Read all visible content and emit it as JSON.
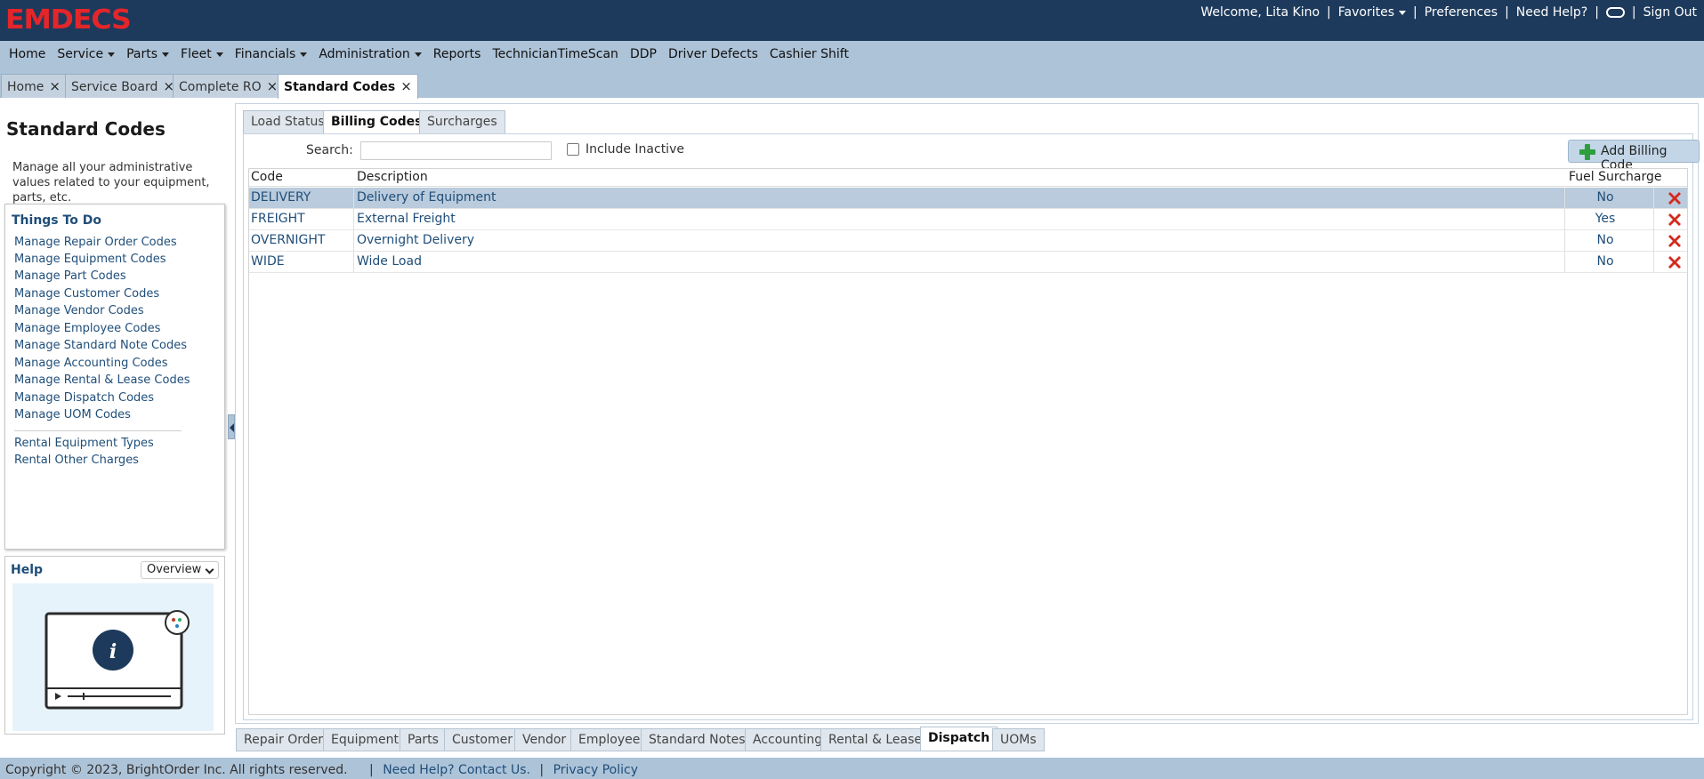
{
  "app": {
    "logo_text": "EMDECS",
    "brand_color": "#e4262b",
    "header_color": "#1d3a5c",
    "accent_color": "#adc3d8"
  },
  "user_bar": {
    "welcome": "Welcome, Lita Kino",
    "favorites": "Favorites",
    "preferences": "Preferences",
    "need_help": "Need Help?",
    "chat_icon": "pill-icon",
    "sign_out": "Sign Out"
  },
  "main_menu": [
    {
      "label": "Home",
      "dropdown": false
    },
    {
      "label": "Service",
      "dropdown": true
    },
    {
      "label": "Parts",
      "dropdown": true
    },
    {
      "label": "Fleet",
      "dropdown": true
    },
    {
      "label": "Financials",
      "dropdown": true
    },
    {
      "label": "Administration",
      "dropdown": true
    },
    {
      "label": "Reports",
      "dropdown": false
    },
    {
      "label": "TechnicianTimeScan",
      "dropdown": false
    },
    {
      "label": "DDP",
      "dropdown": false
    },
    {
      "label": "Driver Defects",
      "dropdown": false
    },
    {
      "label": "Cashier Shift",
      "dropdown": false
    }
  ],
  "page_tabs": [
    {
      "label": "Home",
      "active": false
    },
    {
      "label": "Service Board",
      "active": false
    },
    {
      "label": "Complete RO",
      "active": false
    },
    {
      "label": "Standard Codes",
      "active": true
    }
  ],
  "left_panel": {
    "title": "Standard Codes",
    "description": "Manage all your administrative values related to your equipment, parts, etc.",
    "things_to_do_title": "Things To Do",
    "links": [
      "Manage Repair Order Codes",
      "Manage Equipment Codes",
      "Manage Part Codes",
      "Manage Customer Codes",
      "Manage Vendor Codes",
      "Manage Employee Codes",
      "Manage Standard Note Codes",
      "Manage Accounting Codes",
      "Manage Rental & Lease Codes",
      "Manage Dispatch Codes",
      "Manage UOM Codes"
    ],
    "extra_links": [
      "Rental Equipment Types",
      "Rental Other Charges"
    ],
    "help_title": "Help",
    "help_select_value": "Overview",
    "help_image_icon": "video-info-icon"
  },
  "inner_tabs": [
    {
      "label": "Load Status",
      "active": false
    },
    {
      "label": "Billing Codes",
      "active": true
    },
    {
      "label": "Surcharges",
      "active": false
    }
  ],
  "toolbar": {
    "search_label": "Search:",
    "search_value": "",
    "search_placeholder": "",
    "include_inactive_label": "Include Inactive",
    "include_inactive_checked": false,
    "add_button_label": "Add Billing Code",
    "add_icon": "plus-icon",
    "delete_icon": "trash-icon"
  },
  "grid": {
    "columns": [
      "Code",
      "Description",
      "Fuel Surcharge"
    ],
    "rows": [
      {
        "code": "DELIVERY",
        "description": "Delivery of Equipment",
        "fuel_surcharge": "No",
        "selected": true
      },
      {
        "code": "FREIGHT",
        "description": "External Freight",
        "fuel_surcharge": "Yes",
        "selected": false
      },
      {
        "code": "OVERNIGHT",
        "description": "Overnight Delivery",
        "fuel_surcharge": "No",
        "selected": false
      },
      {
        "code": "WIDE",
        "description": "Wide Load",
        "fuel_surcharge": "No",
        "selected": false
      }
    ],
    "row_delete_icon": "red-x-icon"
  },
  "bottom_tabs": [
    {
      "label": "Repair Order",
      "active": false
    },
    {
      "label": "Equipment",
      "active": false
    },
    {
      "label": "Parts",
      "active": false
    },
    {
      "label": "Customer",
      "active": false
    },
    {
      "label": "Vendor",
      "active": false
    },
    {
      "label": "Employee",
      "active": false
    },
    {
      "label": "Standard Notes",
      "active": false
    },
    {
      "label": "Accounting",
      "active": false
    },
    {
      "label": "Rental & Lease",
      "active": false
    },
    {
      "label": "Dispatch",
      "active": true
    },
    {
      "label": "UOMs",
      "active": false
    }
  ],
  "footer": {
    "copyright": "Copyright © 2023, BrightOrder Inc. All rights reserved.",
    "contact": "Need Help? Contact Us.",
    "privacy": "Privacy Policy"
  }
}
